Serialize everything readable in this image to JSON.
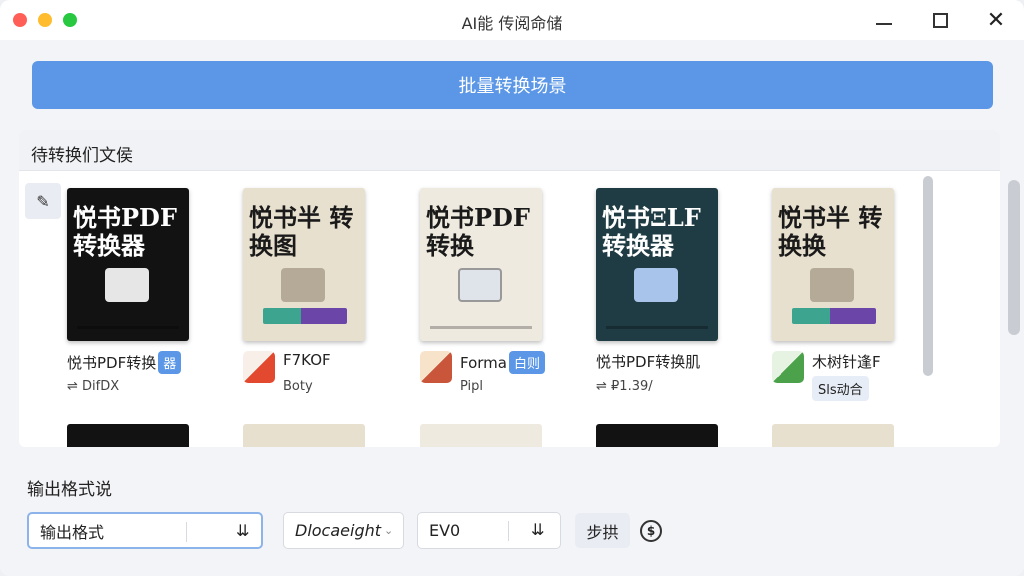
{
  "window": {
    "title": "AI能 传阅命储"
  },
  "batch_button": {
    "label": "批量转换场景"
  },
  "files_panel": {
    "title": "待转换们文侯",
    "items": [
      {
        "cover_title": "悦书PDF 转换器",
        "label": "悦书PDF转换",
        "badge": "器",
        "meta": "DifDX"
      },
      {
        "cover_title": "悦书半 转换图",
        "label": "F7KOF",
        "meta": "Boty"
      },
      {
        "cover_title": "悦书PDF 转换",
        "label": "Forma",
        "badge": "白则",
        "meta": "Pipl"
      },
      {
        "cover_title": "悦书ΞLF 转换器",
        "label": "悦书PDF转换肌",
        "meta": "₽1.39/"
      },
      {
        "cover_title": "悦书半 转换换",
        "label": "木树针逢F",
        "badge": "Sls动合"
      }
    ]
  },
  "output": {
    "section_label": "输出格式说",
    "format_value": "输出格式",
    "doc_value": "Dlocaeight",
    "code_value": "EV0",
    "step_button": "步拱",
    "coin_symbol": "$"
  }
}
